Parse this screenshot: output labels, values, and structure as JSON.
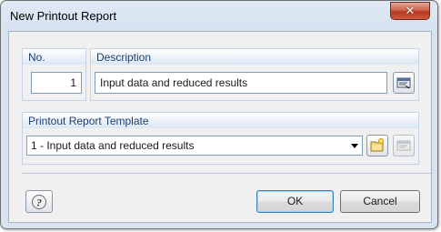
{
  "dialog": {
    "title": "New Printout Report",
    "close_icon": "close-x-icon"
  },
  "number_group": {
    "label": "No.",
    "value": "1"
  },
  "description_group": {
    "label": "Description",
    "value": "Input data and reduced results",
    "select_icon": "select-from-list-icon"
  },
  "template_group": {
    "label": "Printout Report Template",
    "selected": "1 - Input data and reduced results",
    "new_icon": "new-template-icon",
    "edit_icon": "edit-template-icon"
  },
  "footer": {
    "help_icon": "help-icon",
    "ok_label": "OK",
    "cancel_label": "Cancel"
  }
}
